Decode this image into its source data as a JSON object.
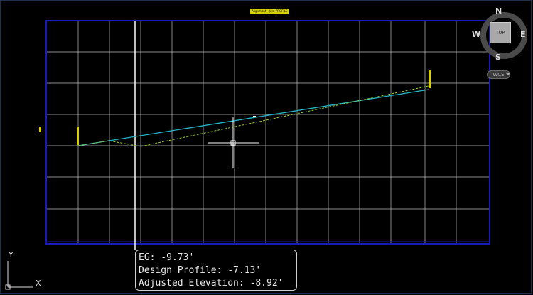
{
  "profile": {
    "title": "Alignment - (on) PROFILE",
    "subtitle": "~~~~"
  },
  "viewcube": {
    "top_label": "TOP",
    "north": "N",
    "south": "S",
    "east": "E",
    "west": "W",
    "wcs_label": "WCS"
  },
  "tooltip": {
    "eg": "EG: -9.73'",
    "design_profile": "Design Profile: -7.13'",
    "adjusted_elevation": "Adjusted Elevation: -8.92'"
  },
  "ucs": {
    "x": "X",
    "y": "Y"
  },
  "colors": {
    "background": "#000000",
    "grid": "#c8c8c8",
    "border": "#1a1ab8",
    "design_profile": "#22b7c8",
    "existing_ground": "#9acd32",
    "annotation": "#d8d000",
    "cursor": "#ffffff"
  }
}
